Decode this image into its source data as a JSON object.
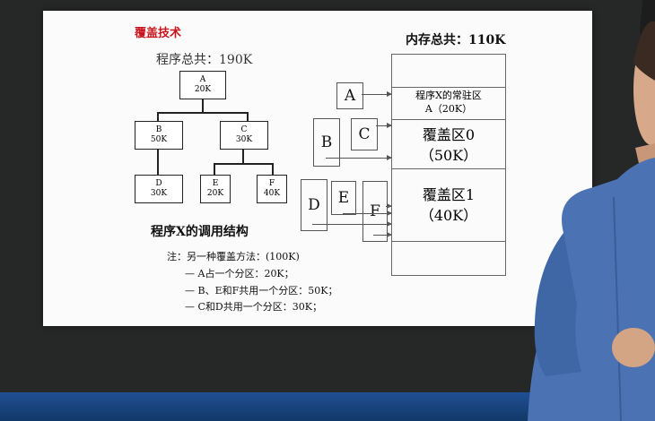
{
  "slide": {
    "title": "覆盖技术",
    "program_total": "程序总共：190K",
    "memory_total": "内存总共：110K",
    "tree": {
      "A": {
        "name": "A",
        "size": "20K"
      },
      "B": {
        "name": "B",
        "size": "50K"
      },
      "C": {
        "name": "C",
        "size": "30K"
      },
      "D": {
        "name": "D",
        "size": "30K"
      },
      "E": {
        "name": "E",
        "size": "20K"
      },
      "F": {
        "name": "F",
        "size": "40K"
      }
    },
    "caption": "程序X的调用结构",
    "notes": [
      "注：另一种覆盖方法：(100K)",
      "— A占一个分区：20K；",
      "— B、E和F共用一个分区：50K；",
      "— C和D共用一个分区：30K；"
    ],
    "memory": {
      "resident_line1": "程序X的常驻区",
      "resident_line2": "A（20K）",
      "overlay0_name": "覆盖区0",
      "overlay0_size": "（50K）",
      "overlay1_name": "覆盖区1",
      "overlay1_size": "（40K）"
    },
    "modules": {
      "A": "A",
      "B": "B",
      "C": "C",
      "D": "D",
      "E": "E",
      "F": "F"
    }
  }
}
